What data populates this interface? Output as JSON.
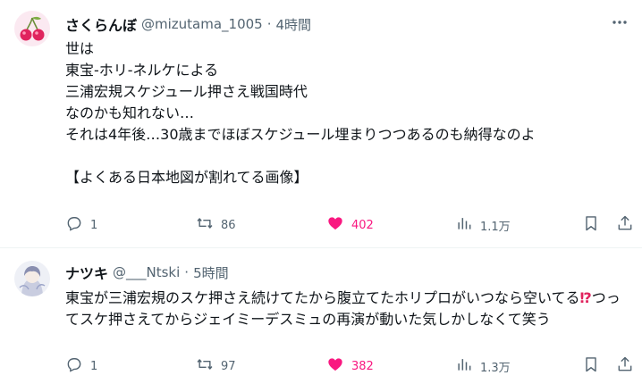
{
  "tweets": [
    {
      "author_name": "さくらんぼ",
      "author_handle": "@mizutama_1005",
      "separator": "·",
      "time": "4時間",
      "avatar_icon": "cherry-avatar-icon",
      "body": "世は\n東宝-ホリ-ネルケによる\n三浦宏規スケジュール押さえ戦国時代\nなのかも知れない…\nそれは4年後…30歳までほぼスケジュール埋まりつつあるのも納得なのよ\n\n【よくある日本地図が割れてる画像】",
      "replies": "1",
      "reposts": "86",
      "likes": "402",
      "views": "1.1万",
      "liked": true
    },
    {
      "author_name": "ナツキ",
      "author_handle": "@___Ntski",
      "separator": "·",
      "time": "5時間",
      "avatar_icon": "illustration-avatar-icon",
      "body_part1": "東宝が三浦宏規のスケ押さえ続けてたから腹立てたホリプロがいつなら空いてる",
      "body_emoji": "⁉",
      "body_part2": "つってスケ押さえてからジェイミーデスミュの再演が動いた気しかしなくて笑う",
      "replies": "1",
      "reposts": "97",
      "likes": "382",
      "views": "1.3万",
      "liked": true
    }
  ],
  "colors": {
    "text": "#0f1419",
    "muted": "#536471",
    "like": "#f91880",
    "divider": "#eff3f4"
  }
}
